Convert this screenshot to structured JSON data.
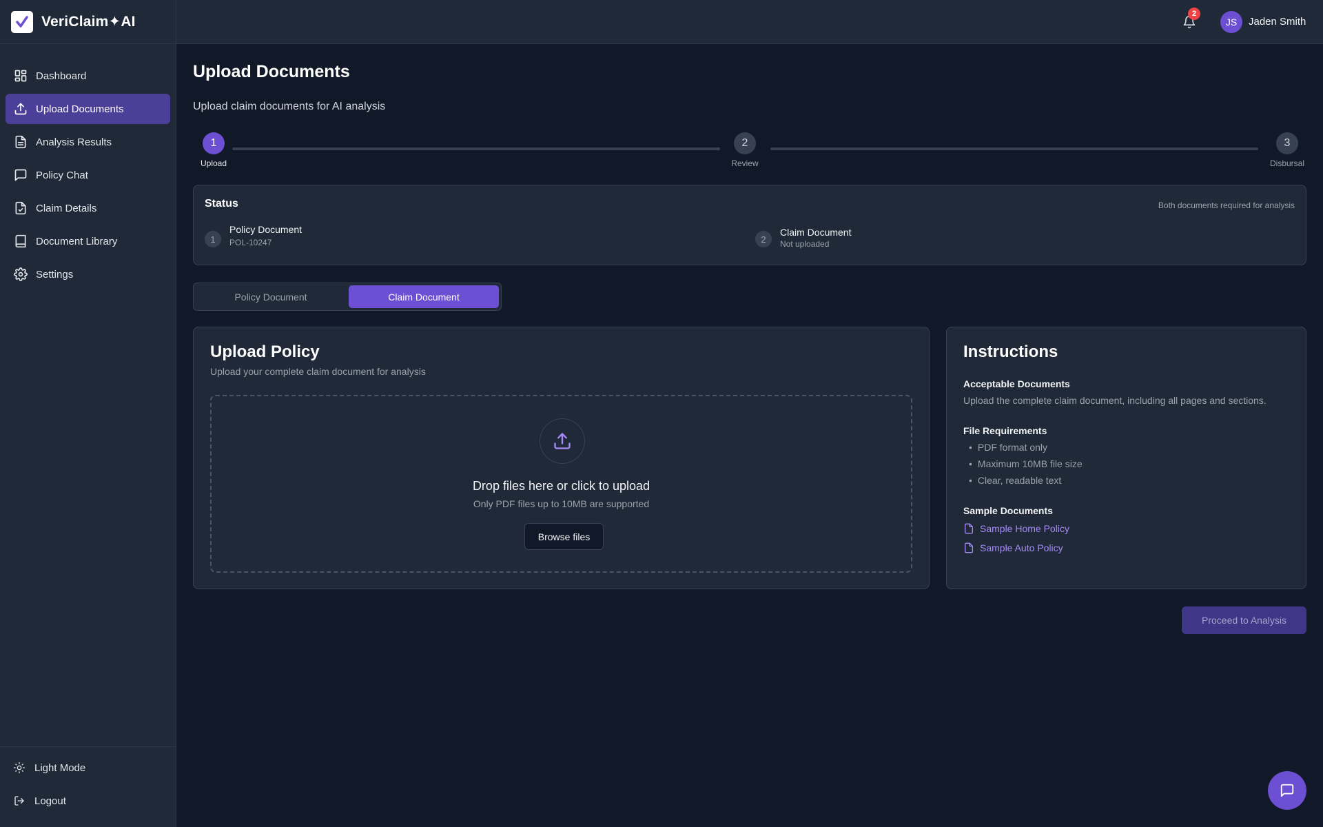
{
  "app": {
    "name": "VeriClaim✦AI"
  },
  "sidebar": {
    "items": [
      {
        "label": "Dashboard",
        "icon": "dashboard-icon"
      },
      {
        "label": "Upload Documents",
        "icon": "upload-icon",
        "active": true
      },
      {
        "label": "Analysis Results",
        "icon": "file-text-icon"
      },
      {
        "label": "Policy Chat",
        "icon": "message-icon"
      },
      {
        "label": "Claim Details",
        "icon": "file-check-icon"
      },
      {
        "label": "Document Library",
        "icon": "book-icon"
      },
      {
        "label": "Settings",
        "icon": "gear-icon"
      }
    ],
    "bottom": [
      {
        "label": "Light Mode",
        "icon": "sun-icon"
      },
      {
        "label": "Logout",
        "icon": "logout-icon"
      }
    ]
  },
  "header": {
    "notification_count": "2",
    "user": {
      "initials": "JS",
      "name": "Jaden Smith"
    }
  },
  "page": {
    "title": "Upload Documents",
    "subtitle": "Upload claim documents for AI analysis"
  },
  "stepper": {
    "steps": [
      {
        "number": "1",
        "label": "Upload",
        "active": true
      },
      {
        "number": "2",
        "label": "Review"
      },
      {
        "number": "3",
        "label": "Disbursal"
      }
    ]
  },
  "status": {
    "title": "Status",
    "note": "Both documents required for analysis",
    "items": [
      {
        "number": "1",
        "name": "Policy Document",
        "sub": "POL-10247"
      },
      {
        "number": "2",
        "name": "Claim Document",
        "sub": "Not uploaded"
      }
    ]
  },
  "tabs": {
    "items": [
      {
        "label": "Policy Document"
      },
      {
        "label": "Claim Document",
        "active": true
      }
    ]
  },
  "upload": {
    "title": "Upload Policy",
    "subtitle": "Upload your complete claim document for analysis",
    "drop_title": "Drop files here or click to upload",
    "drop_sub": "Only PDF files up to 10MB are supported",
    "browse_label": "Browse files"
  },
  "instructions": {
    "title": "Instructions",
    "acceptable_heading": "Acceptable Documents",
    "acceptable_text": "Upload the complete claim document, including all pages and sections.",
    "requirements_heading": "File Requirements",
    "requirements": [
      "PDF format only",
      "Maximum 10MB file size",
      "Clear, readable text"
    ],
    "samples_heading": "Sample Documents",
    "samples": [
      "Sample Home Policy",
      "Sample Auto Policy"
    ]
  },
  "actions": {
    "proceed_label": "Proceed to Analysis"
  },
  "colors": {
    "accent": "#6d4fd4",
    "background": "#111827",
    "surface": "#1f2937",
    "badge": "#ef4444",
    "link": "#a78bfa"
  }
}
